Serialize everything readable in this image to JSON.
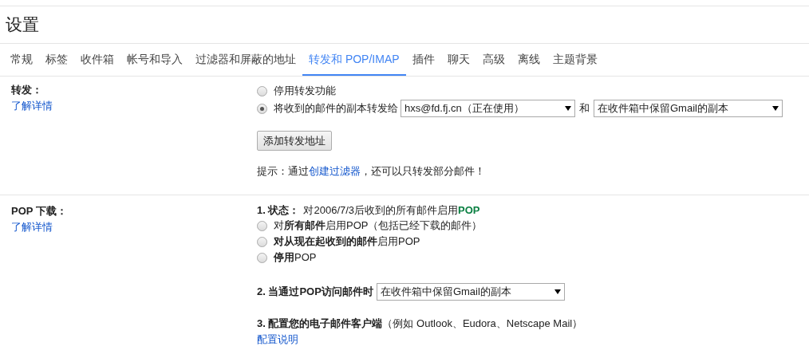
{
  "title": "设置",
  "tabs": [
    {
      "label": "常规",
      "selected": false
    },
    {
      "label": "标签",
      "selected": false
    },
    {
      "label": "收件箱",
      "selected": false
    },
    {
      "label": "帐号和导入",
      "selected": false
    },
    {
      "label": "过滤器和屏蔽的地址",
      "selected": false
    },
    {
      "label": "转发和 POP/IMAP",
      "selected": true
    },
    {
      "label": "插件",
      "selected": false
    },
    {
      "label": "聊天",
      "selected": false
    },
    {
      "label": "高级",
      "selected": false
    },
    {
      "label": "离线",
      "selected": false
    },
    {
      "label": "主题背景",
      "selected": false
    }
  ],
  "forwarding": {
    "label": "转发：",
    "learn_more": "了解详情",
    "options": [
      {
        "label": "停用转发功能",
        "selected": false
      },
      {
        "label": "将收到的邮件的副本转发给",
        "selected": true
      }
    ],
    "address_select": "hxs@fd.fj.cn（正在使用）",
    "and": "和",
    "action_select": "在收件箱中保留Gmail的副本",
    "add_button": "添加转发地址",
    "hint_before": "提示：通过",
    "hint_link": "创建过滤器",
    "hint_after": "，还可以只转发部分邮件！"
  },
  "pop": {
    "label": "POP 下载：",
    "learn_more": "了解详情",
    "status_label": "1. 状态：",
    "status_text": "对2006/7/3后收到的所有邮件启用",
    "status_value": "POP",
    "options": [
      {
        "label": "对**所有邮件**启用POP（包括已经下载的邮件）",
        "selected": false
      },
      {
        "label": "**对从现在起收到的邮件**启用POP",
        "selected": false
      },
      {
        "label": "**停用**POP",
        "selected": false
      }
    ],
    "access_label": "2. 当通过POP访问邮件时",
    "access_select": "在收件箱中保留Gmail的副本",
    "client_label": "3. 配置您的电子邮件客户端",
    "client_note": "（例如 Outlook、Eudora、Netscape Mail）",
    "client_link": "配置说明"
  }
}
